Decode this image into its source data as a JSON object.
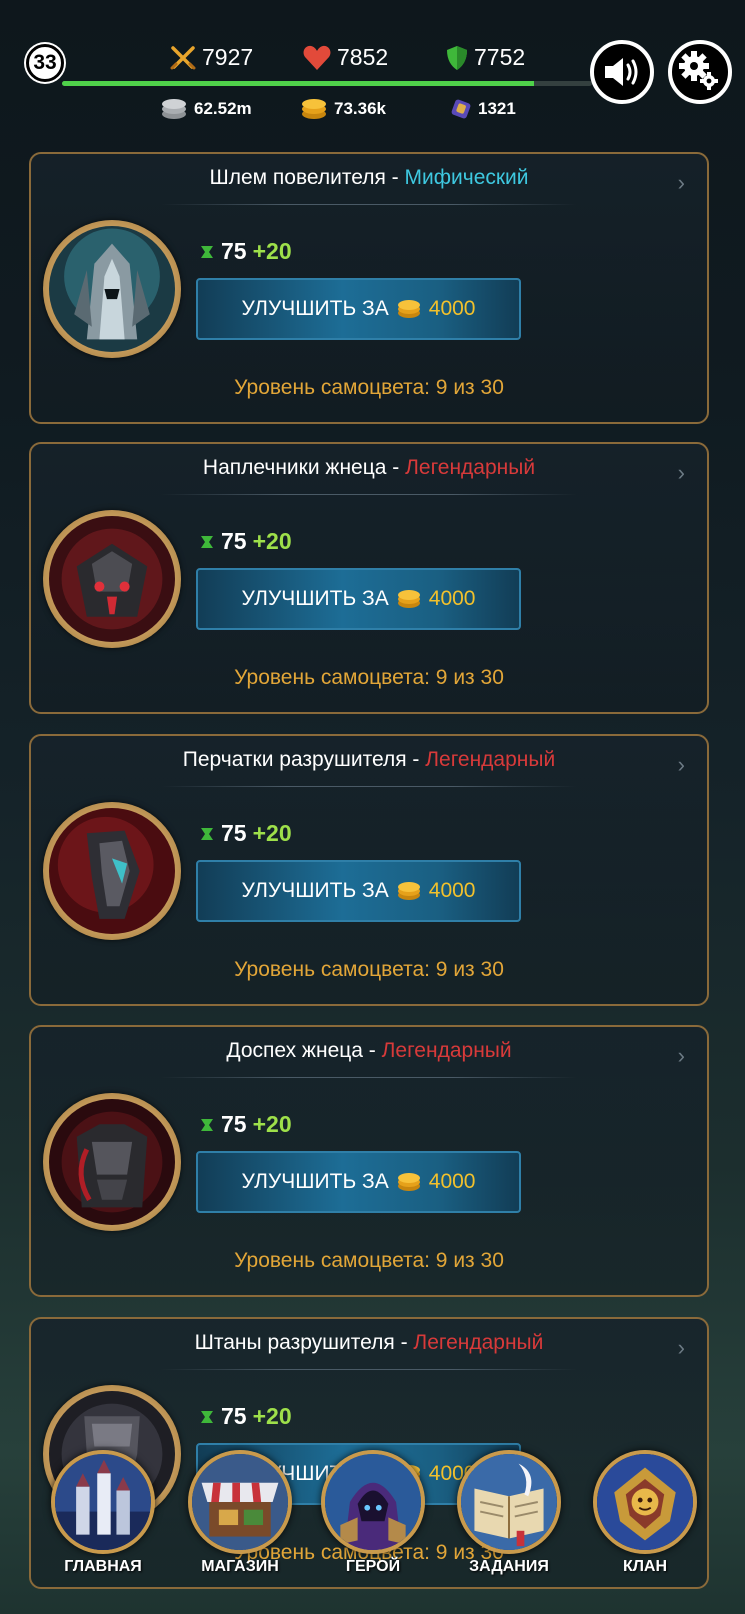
{
  "player": {
    "level": "33",
    "xp_progress": 0.89
  },
  "stats": {
    "attack": "7927",
    "health": "7852",
    "defense": "7752",
    "silver": "62.52m",
    "gold": "73.36k",
    "gems": "1321"
  },
  "upgrade_label": "УЛУЧШИТЬ ЗА",
  "items": [
    {
      "name": "Шлем повелителя",
      "separator": " - ",
      "rarity": "Мифический",
      "power": "75",
      "bonus": "+20",
      "price": "4000",
      "gem_level": "Уровень самоцвета: 9 из 30"
    },
    {
      "name": "Наплечники жнеца",
      "separator": " - ",
      "rarity": "Легендарный",
      "power": "75",
      "bonus": "+20",
      "price": "4000",
      "gem_level": "Уровень самоцвета: 9 из 30"
    },
    {
      "name": "Перчатки разрушителя",
      "separator": " - ",
      "rarity": "Легендарный",
      "power": "75",
      "bonus": "+20",
      "price": "4000",
      "gem_level": "Уровень самоцвета: 9 из 30"
    },
    {
      "name": "Доспех жнеца",
      "separator": " - ",
      "rarity": "Легендарный",
      "power": "75",
      "bonus": "+20",
      "price": "4000",
      "gem_level": "Уровень самоцвета: 9 из 30"
    },
    {
      "name": "Штаны разрушителя",
      "separator": " - ",
      "rarity": "Легендарный",
      "power": "75",
      "bonus": "+20",
      "price": "4000",
      "gem_level": "Уровень самоцвета: 9 из 30"
    }
  ],
  "nav": [
    {
      "label": "ГЛАВНАЯ",
      "icon": "castle-icon"
    },
    {
      "label": "МАГАЗИН",
      "icon": "shop-icon"
    },
    {
      "label": "ГЕРОЙ",
      "icon": "hero-icon"
    },
    {
      "label": "ЗАДАНИЯ",
      "icon": "quest-book-icon"
    },
    {
      "label": "КЛАН",
      "icon": "clan-emblem-icon"
    }
  ],
  "colors": {
    "card_border": "#8a6a3a",
    "mythic": "#3ec8e0",
    "legendary": "#d83a3a",
    "gem_level": "#e2a638",
    "bonus": "#9ee04a",
    "price": "#f2c12c",
    "xp_bar": "#4fd14a"
  }
}
